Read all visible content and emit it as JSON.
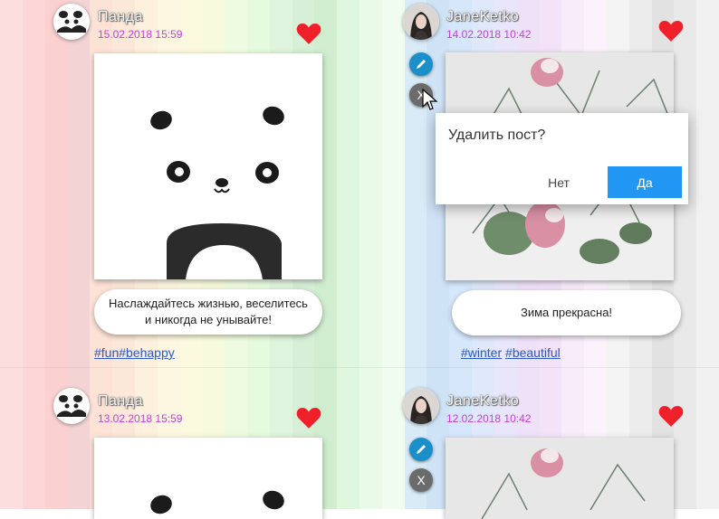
{
  "background_stripes": [
    "#fddede",
    "#fdd7d7",
    "#fbd0d0",
    "#f3d3d3",
    "#fde2d6",
    "#fbe8d8",
    "#fdf0dc",
    "#fdf6e0",
    "#fbfade",
    "#f7fadc",
    "#eefbe0",
    "#e6fadd",
    "#dff4dc",
    "#d6efd6",
    "#d0eecf",
    "#dff6df",
    "#e9fae9",
    "#f0fcf0",
    "#d8ebf6",
    "#cfe3f6",
    "#d6e7fb",
    "#dfe9fb",
    "#e9e6fb",
    "#efe1f8",
    "#f3e2f8",
    "#f8ecfb",
    "#fbf2fc",
    "#f4f4f4",
    "#ececec",
    "#e2e2e2",
    "#e9e9e9",
    "#f1f1f1"
  ],
  "posts": [
    {
      "author": "Панда",
      "date": "15.02.2018 15:59",
      "avatar": "panda-avatar",
      "caption": "Наслаждайтесь жизнью, веселитесь и никогда не унывайте!",
      "tags": [
        "#fun",
        "#behappy"
      ],
      "liked": true
    },
    {
      "author": "JaneKetko",
      "date": "14.02.2018 10:42",
      "avatar": "jane-avatar",
      "caption": "Зима прекрасна!",
      "tags": [
        "#winter",
        "#beautiful"
      ],
      "liked": true,
      "edit_icon": "pencil-icon",
      "delete_label": "X"
    },
    {
      "author": "Панда",
      "date": "13.02.2018 15:59",
      "avatar": "panda-avatar",
      "liked": true
    },
    {
      "author": "JaneKetko",
      "date": "12.02.2018 10:42",
      "avatar": "jane-avatar",
      "liked": true,
      "edit_icon": "pencil-icon",
      "delete_label": "X"
    }
  ],
  "dialog": {
    "question": "Удалить пост?",
    "no_label": "Нет",
    "yes_label": "Да"
  },
  "colors": {
    "heart": "#f0202a",
    "date": "#c23edc",
    "tag": "#2a57c6",
    "primary": "#2196f3",
    "edit": "#1b8fc9"
  }
}
